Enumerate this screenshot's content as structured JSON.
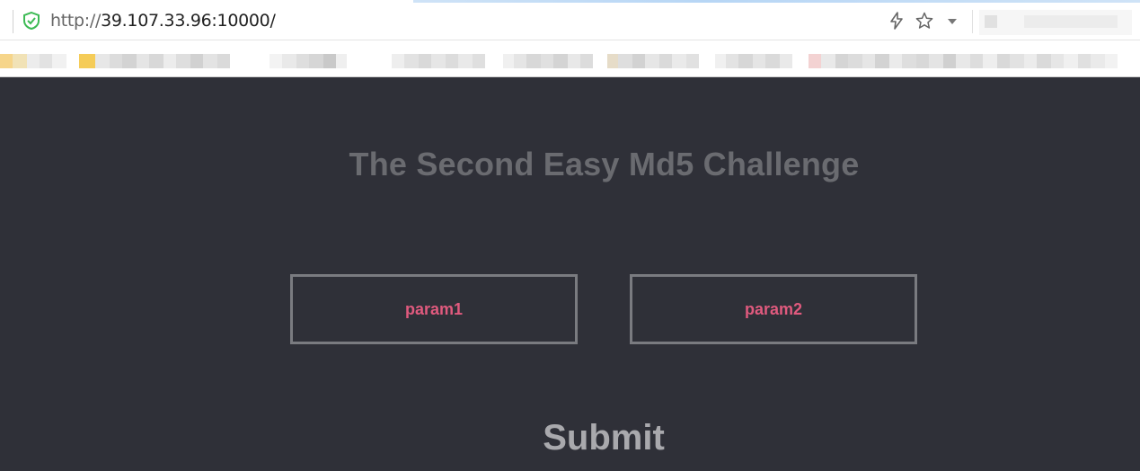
{
  "browser": {
    "url_protocol": "http://",
    "url_host": "39.107.33.96:10000/",
    "icons": [
      "shield-check-icon",
      "bolt-icon",
      "star-icon",
      "chevron-down-icon"
    ],
    "colors": {
      "shield": "#3cba54",
      "accent_bar": "#b7d6f5"
    }
  },
  "page": {
    "title": "The Second Easy Md5 Challenge",
    "fields": {
      "param1_placeholder": "param1",
      "param2_placeholder": "param2"
    },
    "submit_label": "Submit",
    "colors": {
      "background": "#2f3038",
      "title": "#6a6b70",
      "field_text": "#e05a7e",
      "field_border": "#7a7b80",
      "submit_text": "#a9a9ad"
    }
  }
}
